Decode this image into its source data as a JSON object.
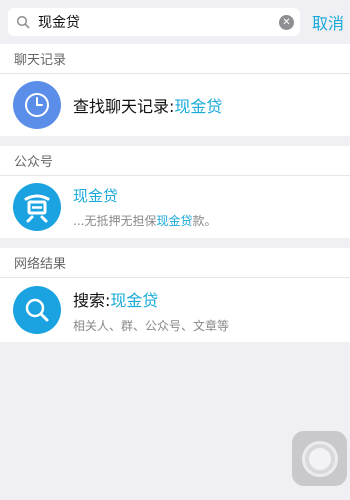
{
  "search": {
    "value": "现金贷",
    "cancel_label": "取消"
  },
  "chat_section": {
    "header": "聊天记录",
    "item": {
      "title_prefix": "查找聊天记录:",
      "title_keyword": "现金贷"
    }
  },
  "official_section": {
    "header": "公众号",
    "item": {
      "title": "现金贷",
      "desc_prefix": "...无抵押无担保",
      "desc_keyword": "现金贷",
      "desc_suffix": "款。"
    }
  },
  "web_section": {
    "header": "网络结果",
    "item": {
      "title_prefix": "搜索:",
      "title_keyword": "现金贷",
      "desc": "相关人、群、公众号、文章等"
    }
  },
  "colors": {
    "accent": "#1aaad9",
    "chat_icon_bg": "#5a8ee8",
    "official_icon_bg": "#1aa3e0",
    "web_icon_bg": "#1aa3e0",
    "background": "#efeff4"
  },
  "icons": {
    "search": "search-icon",
    "clear": "clear-icon",
    "chat_history": "clock-icon",
    "official_account": "loan-logo-icon",
    "web_search": "magnifier-icon",
    "assistive_touch": "assistive-touch-icon"
  }
}
